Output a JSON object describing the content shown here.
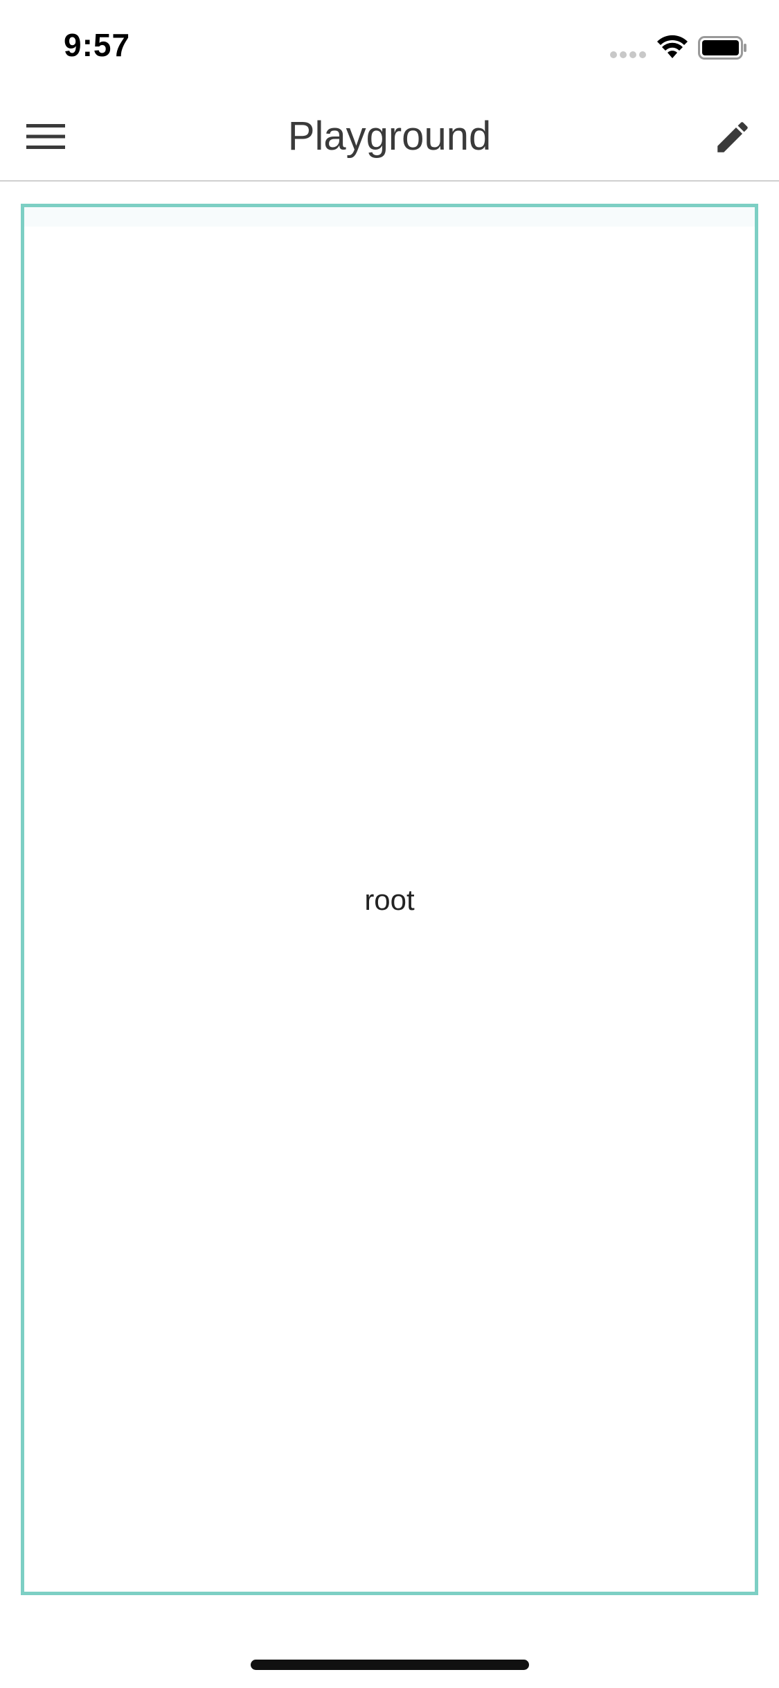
{
  "status_bar": {
    "time": "9:57",
    "icons": [
      "signal-icon",
      "wifi-icon",
      "battery-icon"
    ]
  },
  "nav": {
    "title": "Playground",
    "left_icon": "menu-icon",
    "right_icon": "pencil-icon"
  },
  "canvas": {
    "root_label": "root",
    "border_color": "#7dcfc4"
  }
}
